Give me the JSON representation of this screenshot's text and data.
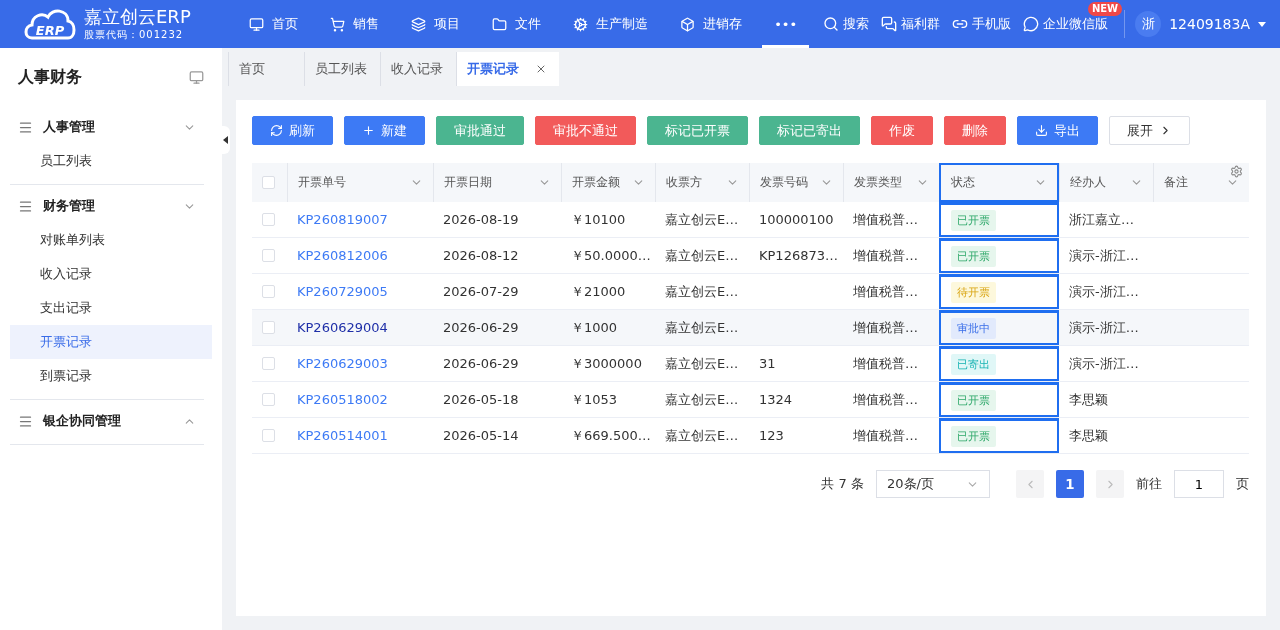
{
  "header": {
    "logo_mark": "ERP",
    "brand": "嘉立创云ERP",
    "stock_code": "股票代码：001232",
    "nav": [
      {
        "label": "首页",
        "selected": false
      },
      {
        "label": "销售",
        "selected": false
      },
      {
        "label": "项目",
        "selected": false
      },
      {
        "label": "文件",
        "selected": false
      },
      {
        "label": "生产制造",
        "selected": false
      },
      {
        "label": "进销存",
        "selected": false
      },
      {
        "label": "•••",
        "selected": true
      }
    ],
    "tools": [
      {
        "label": "搜索"
      },
      {
        "label": "福利群"
      },
      {
        "label": "手机版"
      },
      {
        "label": "企业微信版",
        "badge": "NEW"
      }
    ],
    "avatar": "浙",
    "user": "12409183A"
  },
  "sidebar": {
    "title": "人事财务",
    "groups": [
      {
        "label": "人事管理",
        "expanded": true,
        "children": [
          {
            "label": "员工列表",
            "selected": false
          }
        ]
      },
      {
        "label": "财务管理",
        "expanded": true,
        "children": [
          {
            "label": "对账单列表",
            "selected": false
          },
          {
            "label": "收入记录",
            "selected": false
          },
          {
            "label": "支出记录",
            "selected": false
          },
          {
            "label": "开票记录",
            "selected": true
          },
          {
            "label": "到票记录",
            "selected": false
          }
        ]
      },
      {
        "label": "银企协同管理",
        "expanded": false
      }
    ]
  },
  "tabs": [
    {
      "label": "首页",
      "selected": false
    },
    {
      "label": "员工列表",
      "selected": false
    },
    {
      "label": "收入记录",
      "selected": false
    },
    {
      "label": "开票记录",
      "selected": true
    }
  ],
  "toolbar": [
    {
      "label": "刷新",
      "kind": "primary"
    },
    {
      "label": "新建",
      "kind": "primary"
    },
    {
      "label": "审批通过",
      "kind": "success"
    },
    {
      "label": "审批不通过",
      "kind": "danger"
    },
    {
      "label": "标记已开票",
      "kind": "success"
    },
    {
      "label": "标记已寄出",
      "kind": "success"
    },
    {
      "label": "作废",
      "kind": "danger"
    },
    {
      "label": "删除",
      "kind": "danger"
    },
    {
      "label": "导出",
      "kind": "primary"
    },
    {
      "label": "展开",
      "kind": "plain"
    }
  ],
  "table": {
    "all_checked": false,
    "columns": [
      {
        "label": "开票单号",
        "selected": false
      },
      {
        "label": "开票日期",
        "selected": false
      },
      {
        "label": "开票金额",
        "selected": false
      },
      {
        "label": "收票方",
        "selected": false
      },
      {
        "label": "发票号码",
        "selected": false
      },
      {
        "label": "发票类型",
        "selected": false
      },
      {
        "label": "状态",
        "selected": true
      },
      {
        "label": "经办人",
        "selected": false
      },
      {
        "label": "备注",
        "selected": false
      }
    ],
    "rows": [
      {
        "selected": false,
        "checked": false,
        "no": "KP260819007",
        "date": "2026-08-19",
        "amount": "￥10100",
        "payee": "嘉立创云E…",
        "invoice_no": "100000100",
        "type": "增值税普…",
        "status": {
          "text": "已开票",
          "kind": "issued"
        },
        "handler": "浙江嘉立…"
      },
      {
        "selected": false,
        "checked": false,
        "no": "KP260812006",
        "date": "2026-08-12",
        "amount": "￥50.0000…",
        "payee": "嘉立创云E…",
        "invoice_no": "KP126873…",
        "type": "增值税普…",
        "status": {
          "text": "已开票",
          "kind": "issued"
        },
        "handler": "演示-浙江…"
      },
      {
        "selected": false,
        "checked": false,
        "no": "KP260729005",
        "date": "2026-07-29",
        "amount": "￥21000",
        "payee": "嘉立创云E…",
        "type": "增值税普…",
        "status": {
          "text": "待开票",
          "kind": "pending"
        },
        "handler": "演示-浙江…"
      },
      {
        "selected": true,
        "checked": false,
        "no": "KP260629004",
        "date": "2026-06-29",
        "amount": "￥1000",
        "payee": "嘉立创云E…",
        "type": "增值税普…",
        "status": {
          "text": "审批中",
          "kind": "review"
        },
        "handler": "演示-浙江…"
      },
      {
        "selected": false,
        "checked": false,
        "no": "KP260629003",
        "date": "2026-06-29",
        "amount": "￥3000000",
        "payee": "嘉立创云E…",
        "invoice_no": "31",
        "type": "增值税普…",
        "status": {
          "text": "已寄出",
          "kind": "mailed"
        },
        "handler": "演示-浙江…"
      },
      {
        "selected": false,
        "checked": false,
        "no": "KP260518002",
        "date": "2026-05-18",
        "amount": "￥1053",
        "payee": "嘉立创云E…",
        "invoice_no": "1324",
        "type": "增值税普…",
        "status": {
          "text": "已开票",
          "kind": "issued"
        },
        "handler": "李思颖"
      },
      {
        "selected": false,
        "checked": false,
        "no": "KP260514001",
        "date": "2026-05-14",
        "amount": "￥669.500…",
        "payee": "嘉立创云E…",
        "invoice_no": "123",
        "type": "增值税普…",
        "status": {
          "text": "已开票",
          "kind": "issued"
        },
        "handler": "李思颖"
      }
    ]
  },
  "pagination": {
    "total": "共 7 条",
    "page_size": "20条/页",
    "pages": [
      {
        "label": "1",
        "selected": true
      }
    ],
    "goto_label": "前往",
    "goto_value": "1",
    "goto_suffix": "页"
  }
}
